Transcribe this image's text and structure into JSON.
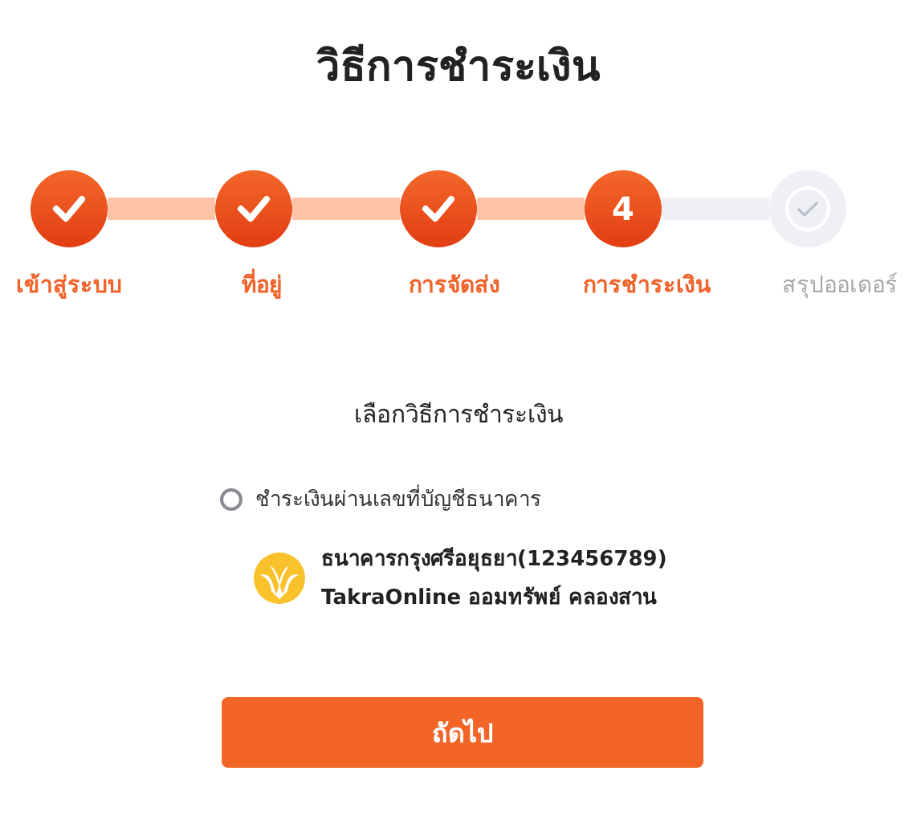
{
  "title": "วิธีการชำระเงิน",
  "steps": [
    {
      "label": "เข้าสู่ระบบ",
      "kind": "done"
    },
    {
      "label": "ที่อยู่",
      "kind": "done"
    },
    {
      "label": "การจัดส่ง",
      "kind": "done"
    },
    {
      "label": "การชำระเงิน",
      "kind": "current",
      "number": "4"
    },
    {
      "label": "สรุปออเดอร์",
      "kind": "pending"
    }
  ],
  "section_title": "เลือกวิธีการชำระเงิน",
  "payment_options": [
    {
      "label": "ชำระเงินผ่านเลขที่บัญชีธนาคาร",
      "selected": false
    }
  ],
  "bank": {
    "name": "ธนาคารกรุงศรีอยุธยา(123456789)",
    "account": "TakraOnline ออมทรัพย์ คลองสาน"
  },
  "next_button": "ถัดไป"
}
